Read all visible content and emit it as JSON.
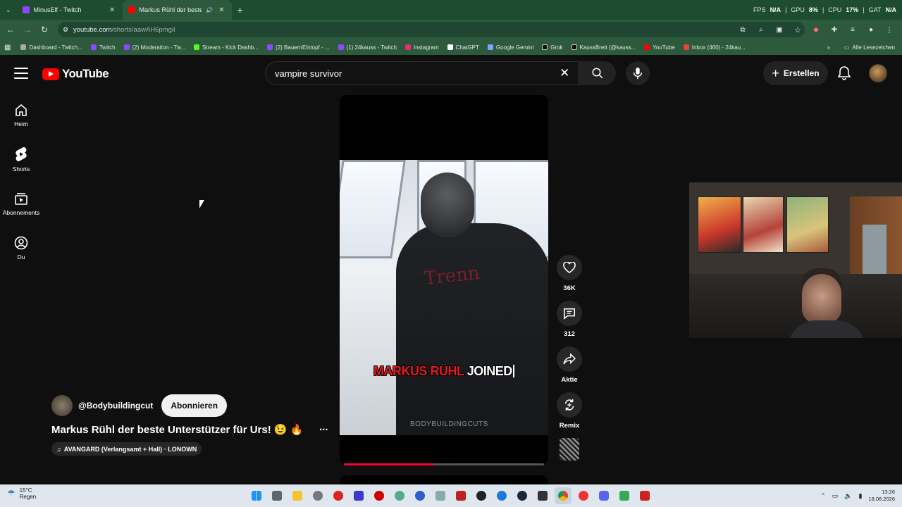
{
  "browser": {
    "tabs": [
      {
        "title": "MinusElf - Twitch",
        "active": false
      },
      {
        "title": "Markus Rühl der beste Unt",
        "active": true
      }
    ],
    "new_tab": "+",
    "perf": {
      "fps_label": "FPS",
      "fps": "N/A",
      "gpu_label": "GPU",
      "gpu": "8%",
      "cpu_label": "CPU",
      "cpu": "17%",
      "gat_label": "GAT",
      "gat": "N/A"
    },
    "url_host": "youtube.com",
    "url_path": "/shorts/aawAH6pmgiI",
    "bookmarks": [
      "Dashboard - Twitch...",
      "Twitch",
      "(2) Moderation - Tw...",
      "Stream - Kick Dashb...",
      "(2) BauernEintopf - ...",
      "(1) 24kauss - Twitch",
      "Instagram",
      "ChatGPT",
      "Google Gemini",
      "Grok",
      "KaussBrett (@kauss...",
      "YouTube",
      "Inbox (460) - 24kau..."
    ],
    "all_bookmarks": "Alle Lesezeichen"
  },
  "youtube": {
    "logo_text": "YouTube",
    "search_value": "vampire survivor",
    "create_label": "Erstellen",
    "sidebar": [
      {
        "label": "Heim",
        "icon": "home-icon"
      },
      {
        "label": "Shorts",
        "icon": "shorts-icon"
      },
      {
        "label": "Abonnements",
        "icon": "subscriptions-icon"
      },
      {
        "label": "Du",
        "icon": "you-icon"
      }
    ],
    "short": {
      "caption_red": "MARKUS RÜHL",
      "caption_white": "JOINED",
      "watermark": "BODYBUILDINGCUTS",
      "shirt_text": "Trenn",
      "progress": 0.45
    },
    "actions": {
      "likes": "36K",
      "comments": "312",
      "share": "Aktie",
      "remix": "Remix"
    },
    "channel": "@Bodybuildingcut",
    "subscribe": "Abonnieren",
    "title": "Markus Rühl der beste Unterstützer für Urs! 😉 🔥",
    "more": "...",
    "audio": "AVANGARD (Verlangsamt + Hall) · LONOWN"
  },
  "taskbar": {
    "temp": "15°C",
    "condition": "Regen",
    "time": "13:26",
    "date": "18.08.2026"
  }
}
